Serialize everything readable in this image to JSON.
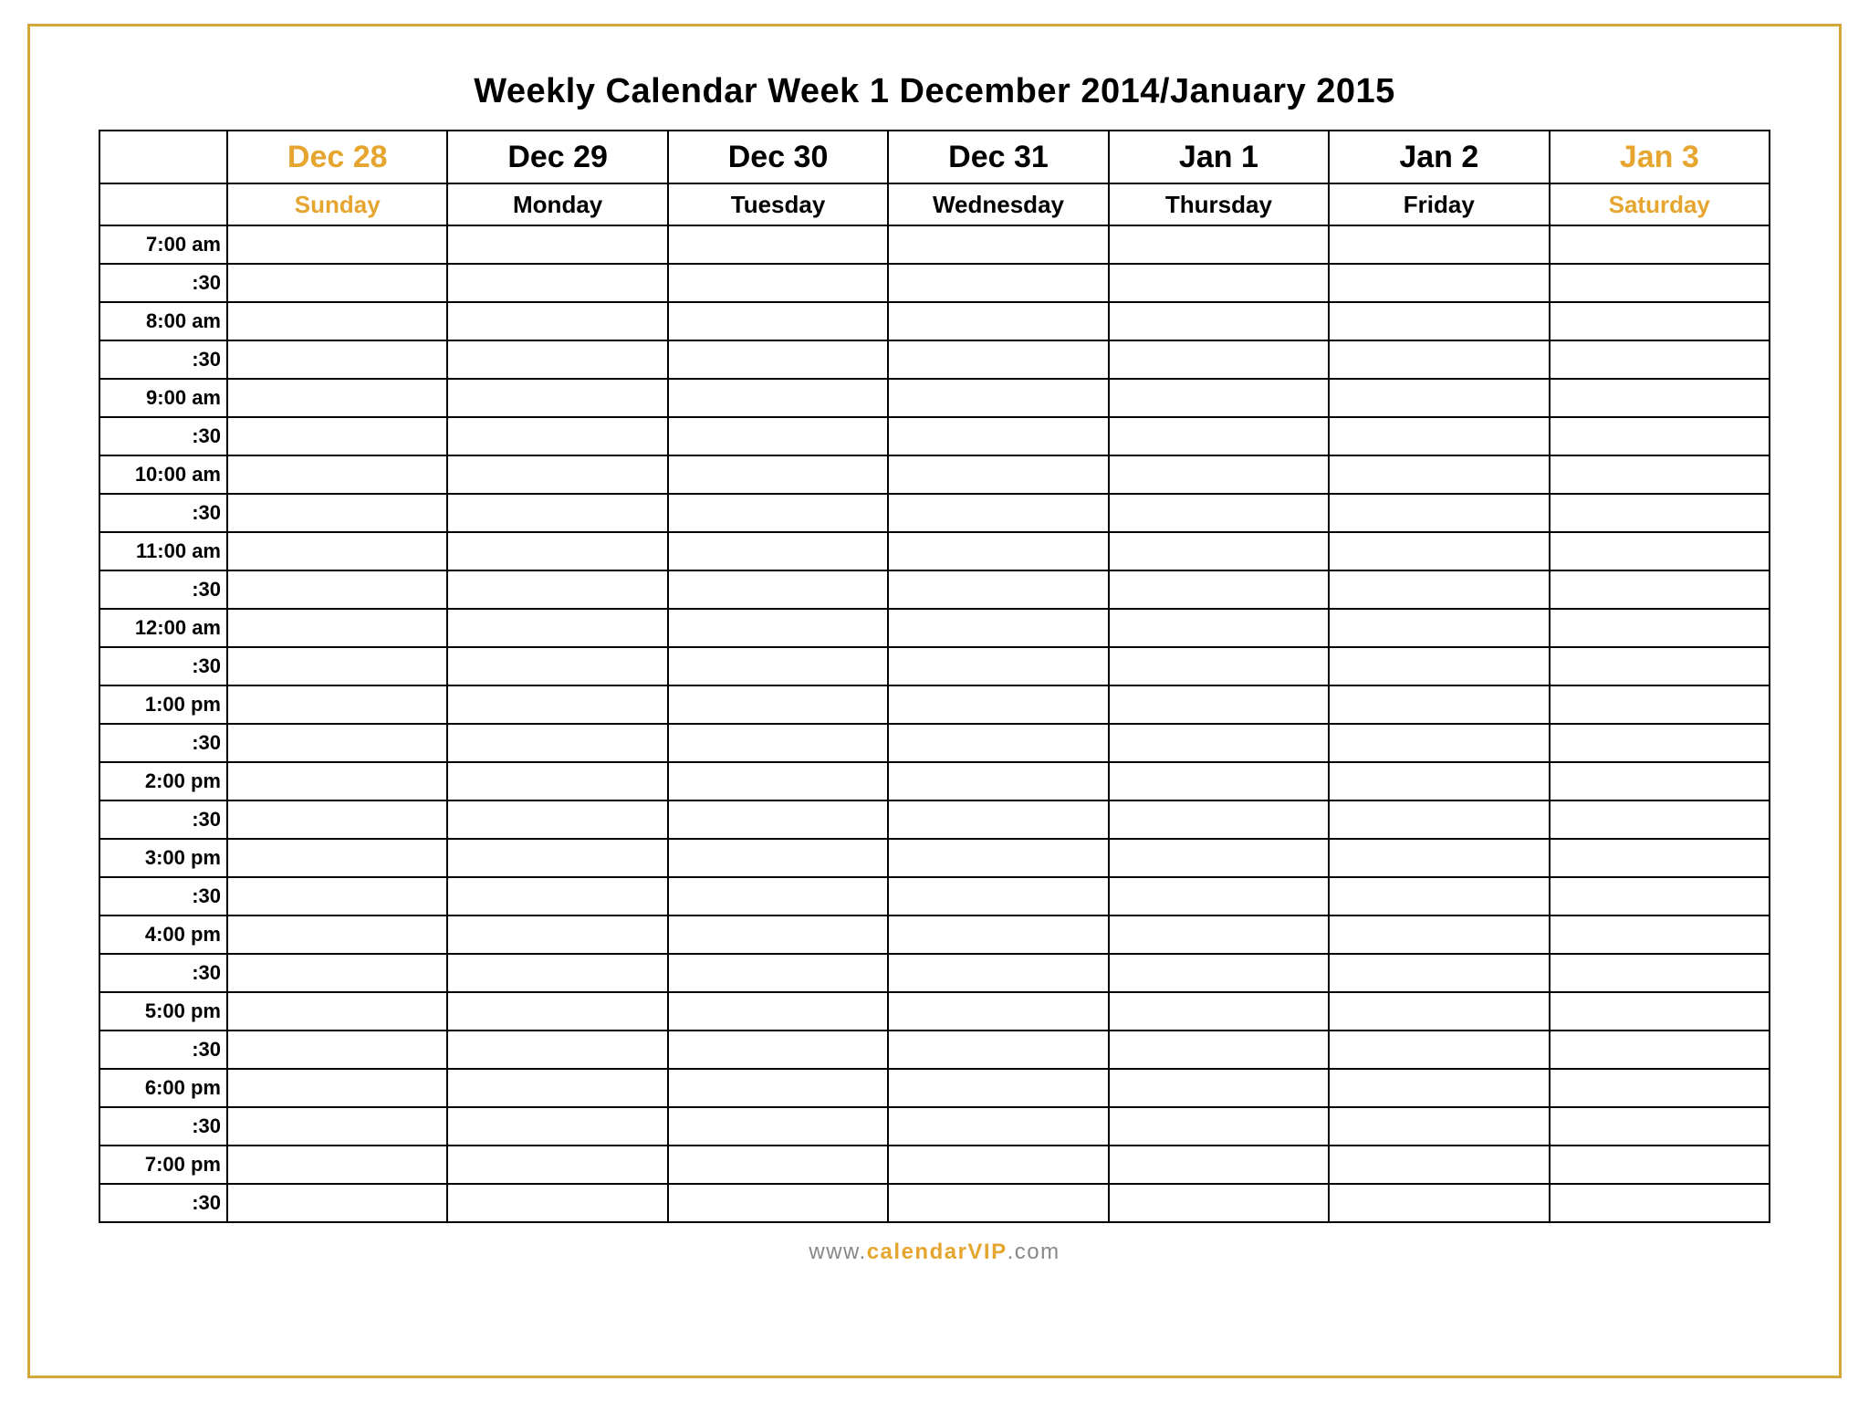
{
  "title": "Weekly Calendar    Week 1    December 2014/January 2015",
  "days": [
    {
      "date": "Dec 28",
      "name": "Sunday",
      "weekend": true
    },
    {
      "date": "Dec 29",
      "name": "Monday",
      "weekend": false
    },
    {
      "date": "Dec 30",
      "name": "Tuesday",
      "weekend": false
    },
    {
      "date": "Dec 31",
      "name": "Wednesday",
      "weekend": false
    },
    {
      "date": "Jan 1",
      "name": "Thursday",
      "weekend": false
    },
    {
      "date": "Jan 2",
      "name": "Friday",
      "weekend": false
    },
    {
      "date": "Jan 3",
      "name": "Saturday",
      "weekend": true
    }
  ],
  "times": [
    "7:00 am",
    ":30",
    "8:00 am",
    ":30",
    "9:00 am",
    ":30",
    "10:00 am",
    ":30",
    "11:00 am",
    ":30",
    "12:00 am",
    ":30",
    "1:00 pm",
    ":30",
    "2:00 pm",
    ":30",
    "3:00 pm",
    ":30",
    "4:00 pm",
    ":30",
    "5:00 pm",
    ":30",
    "6:00 pm",
    ":30",
    "7:00 pm",
    ":30"
  ],
  "footer": {
    "part1": "www.",
    "part2": "calendarVIP",
    "part3": ".com"
  }
}
